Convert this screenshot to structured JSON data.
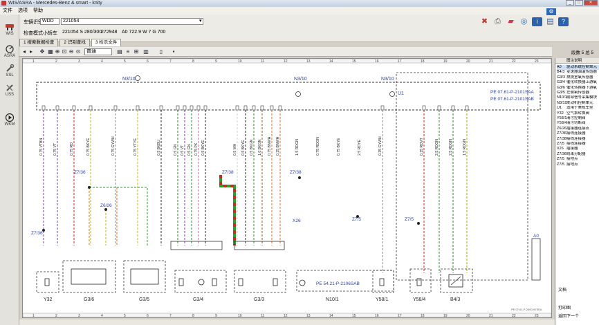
{
  "window": {
    "title": "WIS/ASRA - Mercedes-Benz & smart - knity"
  },
  "menu": [
    "文件",
    "选项",
    "帮助"
  ],
  "leftnav": [
    {
      "label": "WIS",
      "icon": "car-lift-icon"
    },
    {
      "label": "ASRA",
      "icon": "gauge-icon"
    },
    {
      "label": "SSL",
      "icon": "wrench-icon"
    },
    {
      "label": "USS",
      "icon": "tools-icon"
    },
    {
      "label": "WKM",
      "icon": "play-icon"
    }
  ],
  "vehicle": {
    "vin_label": "车辆识别号",
    "vin_prefix": "WDD",
    "vin_value": "221054",
    "filter_label": "检查模式",
    "filter_items": [
      "小轿车",
      "221054 S 280/300",
      "272948",
      "A0 722.9 W 7 G 700"
    ]
  },
  "tabs": [
    {
      "label": "1 搜索数据检查",
      "active": false
    },
    {
      "label": "2 识别查找",
      "active": false
    },
    {
      "label": "3 检示文件",
      "active": true
    }
  ],
  "drawing_toolbar": {
    "zoom_value": "普通",
    "page_count": "段数 5 总 5"
  },
  "legend": {
    "header": "图注说明",
    "items": [
      {
        "code": "A0",
        "text": "驱动系统控制单元"
      },
      {
        "code": "B4/3",
        "text": "变速器油温传感器"
      },
      {
        "code": "G3/3",
        "text": "燃烧室氧传感器"
      },
      {
        "code": "G3/4",
        "text": "催化转换器上游氧"
      },
      {
        "code": "G3/6",
        "text": "催化转换器下游氧"
      },
      {
        "code": "G3/5",
        "text": "左侧氧传感器"
      },
      {
        "code": "N10/1",
        "text": "前部信号采集模块"
      },
      {
        "code": "N3/10",
        "text": "发动机控制单元"
      },
      {
        "code": "U1",
        "text": "适用于美规车型"
      },
      {
        "code": "Y32",
        "text": "空气泵转换阀"
      },
      {
        "code": "Y58/1",
        "text": "清污控制阀"
      },
      {
        "code": "Y58/4",
        "text": "清污切断阀"
      },
      {
        "code": "Z6/26",
        "text": "插接器连接点"
      },
      {
        "code": "Z7/36",
        "text": "接线连接器"
      },
      {
        "code": "Z7/38",
        "text": "接线连接器"
      },
      {
        "code": "Z7/5",
        "text": "接线连接器"
      },
      {
        "code": "X26",
        "text": "插接器"
      },
      {
        "code": "Z7/36",
        "text": "线束分配器"
      },
      {
        "code": "Z7/5",
        "text": "接地点"
      },
      {
        "code": "Z7/5",
        "text": "接地点"
      }
    ],
    "footer": [
      "文档",
      "打印图",
      "返回下一个"
    ]
  },
  "diagram": {
    "ecu_title": "N3/10",
    "u1_label": "U1",
    "pe_refs": [
      "PE 07.61-P-2101SAA",
      "PE 07.61-P-2101SAB",
      "PE 54.21-P-2106SAB"
    ],
    "grid_numbers": [
      "1",
      "2",
      "3",
      "4",
      "5",
      "6",
      "7",
      "8",
      "9",
      "10",
      "11",
      "12",
      "13",
      "14",
      "15",
      "16",
      "17",
      "18",
      "19",
      "20",
      "21",
      "22",
      "23"
    ],
    "components": [
      {
        "id": "Y32"
      },
      {
        "id": "G3/6"
      },
      {
        "id": "G3/5"
      },
      {
        "id": "G3/4"
      },
      {
        "id": "G3/3"
      },
      {
        "id": "N10/1"
      },
      {
        "id": "Y58/1"
      },
      {
        "id": "Y58/4"
      },
      {
        "id": "B4/3"
      },
      {
        "id": "A0"
      }
    ],
    "wire_labels": [
      "0.75 VTBN",
      "0.75 VT",
      "0.75 RD",
      "0.75 BKYE",
      "0.75 GYWH",
      "0.75 YTYE",
      "0.5 BKBU",
      "0.5 GN",
      "0.5 VT",
      "0.5 GN",
      "0.75 PK",
      "0.5 BKYE",
      "0.5 WH",
      "0.5 BKYE",
      "0.5 BKGN",
      "1.0 BKGN",
      "0.75 BNWH",
      "0.35 BNWH",
      "0.35 GYWH",
      "0.35 RDVT",
      "2.5 RDGN",
      "2.5 RDGN",
      "1.5 RDGN",
      "1.5 RDGN",
      "0.75 RDGN",
      "0.75 BKYE",
      "2.5 RDYE"
    ],
    "splices": [
      "Z7/36",
      "Z7/36",
      "Z6/26",
      "Z7/38",
      "Z7/38",
      "Z7/5",
      "Z7/5",
      "X26",
      "Z7/36"
    ],
    "footer_ref": "PE 07.61-P-2000-97SEA"
  }
}
